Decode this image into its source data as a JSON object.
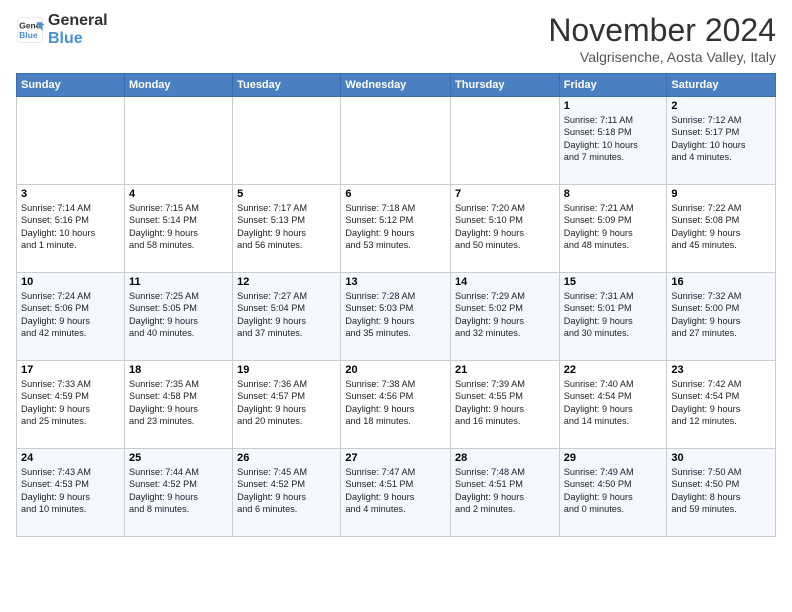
{
  "logo": {
    "line1": "General",
    "line2": "Blue"
  },
  "title": "November 2024",
  "location": "Valgrisenche, Aosta Valley, Italy",
  "weekdays": [
    "Sunday",
    "Monday",
    "Tuesday",
    "Wednesday",
    "Thursday",
    "Friday",
    "Saturday"
  ],
  "weeks": [
    [
      {
        "day": "",
        "info": ""
      },
      {
        "day": "",
        "info": ""
      },
      {
        "day": "",
        "info": ""
      },
      {
        "day": "",
        "info": ""
      },
      {
        "day": "",
        "info": ""
      },
      {
        "day": "1",
        "info": "Sunrise: 7:11 AM\nSunset: 5:18 PM\nDaylight: 10 hours\nand 7 minutes."
      },
      {
        "day": "2",
        "info": "Sunrise: 7:12 AM\nSunset: 5:17 PM\nDaylight: 10 hours\nand 4 minutes."
      }
    ],
    [
      {
        "day": "3",
        "info": "Sunrise: 7:14 AM\nSunset: 5:16 PM\nDaylight: 10 hours\nand 1 minute."
      },
      {
        "day": "4",
        "info": "Sunrise: 7:15 AM\nSunset: 5:14 PM\nDaylight: 9 hours\nand 58 minutes."
      },
      {
        "day": "5",
        "info": "Sunrise: 7:17 AM\nSunset: 5:13 PM\nDaylight: 9 hours\nand 56 minutes."
      },
      {
        "day": "6",
        "info": "Sunrise: 7:18 AM\nSunset: 5:12 PM\nDaylight: 9 hours\nand 53 minutes."
      },
      {
        "day": "7",
        "info": "Sunrise: 7:20 AM\nSunset: 5:10 PM\nDaylight: 9 hours\nand 50 minutes."
      },
      {
        "day": "8",
        "info": "Sunrise: 7:21 AM\nSunset: 5:09 PM\nDaylight: 9 hours\nand 48 minutes."
      },
      {
        "day": "9",
        "info": "Sunrise: 7:22 AM\nSunset: 5:08 PM\nDaylight: 9 hours\nand 45 minutes."
      }
    ],
    [
      {
        "day": "10",
        "info": "Sunrise: 7:24 AM\nSunset: 5:06 PM\nDaylight: 9 hours\nand 42 minutes."
      },
      {
        "day": "11",
        "info": "Sunrise: 7:25 AM\nSunset: 5:05 PM\nDaylight: 9 hours\nand 40 minutes."
      },
      {
        "day": "12",
        "info": "Sunrise: 7:27 AM\nSunset: 5:04 PM\nDaylight: 9 hours\nand 37 minutes."
      },
      {
        "day": "13",
        "info": "Sunrise: 7:28 AM\nSunset: 5:03 PM\nDaylight: 9 hours\nand 35 minutes."
      },
      {
        "day": "14",
        "info": "Sunrise: 7:29 AM\nSunset: 5:02 PM\nDaylight: 9 hours\nand 32 minutes."
      },
      {
        "day": "15",
        "info": "Sunrise: 7:31 AM\nSunset: 5:01 PM\nDaylight: 9 hours\nand 30 minutes."
      },
      {
        "day": "16",
        "info": "Sunrise: 7:32 AM\nSunset: 5:00 PM\nDaylight: 9 hours\nand 27 minutes."
      }
    ],
    [
      {
        "day": "17",
        "info": "Sunrise: 7:33 AM\nSunset: 4:59 PM\nDaylight: 9 hours\nand 25 minutes."
      },
      {
        "day": "18",
        "info": "Sunrise: 7:35 AM\nSunset: 4:58 PM\nDaylight: 9 hours\nand 23 minutes."
      },
      {
        "day": "19",
        "info": "Sunrise: 7:36 AM\nSunset: 4:57 PM\nDaylight: 9 hours\nand 20 minutes."
      },
      {
        "day": "20",
        "info": "Sunrise: 7:38 AM\nSunset: 4:56 PM\nDaylight: 9 hours\nand 18 minutes."
      },
      {
        "day": "21",
        "info": "Sunrise: 7:39 AM\nSunset: 4:55 PM\nDaylight: 9 hours\nand 16 minutes."
      },
      {
        "day": "22",
        "info": "Sunrise: 7:40 AM\nSunset: 4:54 PM\nDaylight: 9 hours\nand 14 minutes."
      },
      {
        "day": "23",
        "info": "Sunrise: 7:42 AM\nSunset: 4:54 PM\nDaylight: 9 hours\nand 12 minutes."
      }
    ],
    [
      {
        "day": "24",
        "info": "Sunrise: 7:43 AM\nSunset: 4:53 PM\nDaylight: 9 hours\nand 10 minutes."
      },
      {
        "day": "25",
        "info": "Sunrise: 7:44 AM\nSunset: 4:52 PM\nDaylight: 9 hours\nand 8 minutes."
      },
      {
        "day": "26",
        "info": "Sunrise: 7:45 AM\nSunset: 4:52 PM\nDaylight: 9 hours\nand 6 minutes."
      },
      {
        "day": "27",
        "info": "Sunrise: 7:47 AM\nSunset: 4:51 PM\nDaylight: 9 hours\nand 4 minutes."
      },
      {
        "day": "28",
        "info": "Sunrise: 7:48 AM\nSunset: 4:51 PM\nDaylight: 9 hours\nand 2 minutes."
      },
      {
        "day": "29",
        "info": "Sunrise: 7:49 AM\nSunset: 4:50 PM\nDaylight: 9 hours\nand 0 minutes."
      },
      {
        "day": "30",
        "info": "Sunrise: 7:50 AM\nSunset: 4:50 PM\nDaylight: 8 hours\nand 59 minutes."
      }
    ]
  ]
}
